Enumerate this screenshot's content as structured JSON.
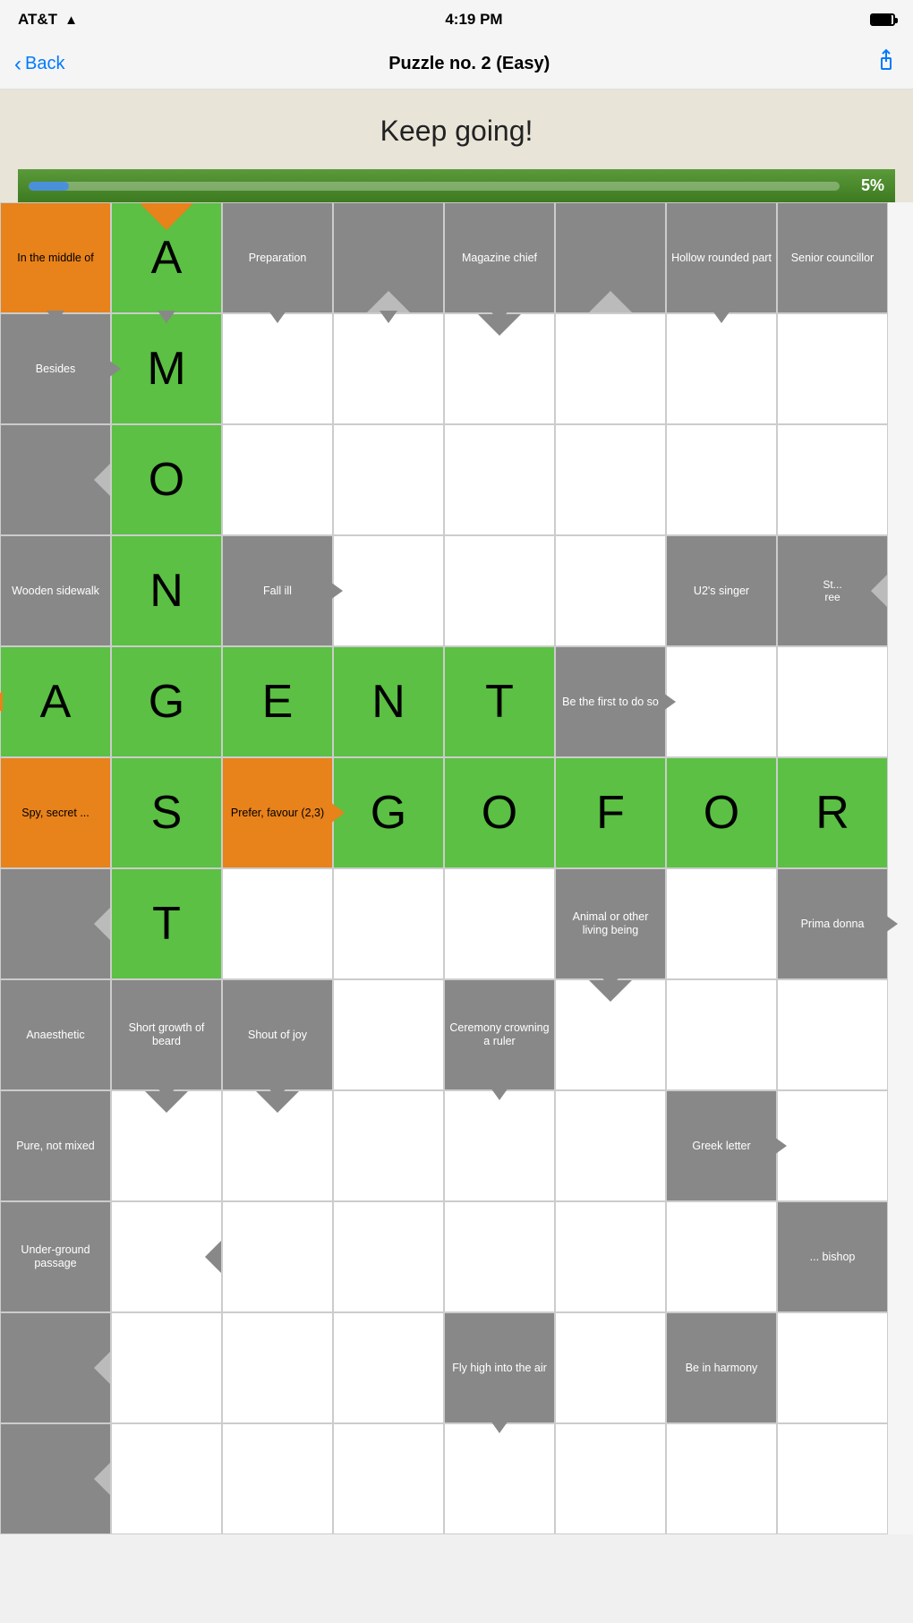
{
  "status": {
    "carrier": "AT&T",
    "time": "4:19 PM"
  },
  "nav": {
    "back_label": "Back",
    "title": "Puzzle no. 2 (Easy)"
  },
  "header": {
    "message": "Keep going!"
  },
  "progress": {
    "percent": "5%",
    "value": 5
  },
  "cells": {
    "r0c0_clue": "In the middle of",
    "r0c1_letter": "A",
    "r0c2_clue": "Preparation",
    "r0c4_clue": "Magazine chief",
    "r0c6_clue": "Hollow rounded part",
    "r0c7_clue": "Senior councillor",
    "r1c0_clue": "Besides",
    "r1c1_letter": "M",
    "r2c1_letter": "O",
    "r3c0_clue": "Wooden sidewalk",
    "r3c1_letter": "N",
    "r3c2_clue": "Fall ill",
    "r3c6_clue": "U2's singer",
    "r4c0_letter": "A",
    "r4c1_letter": "G",
    "r4c2_letter": "E",
    "r4c3_letter": "N",
    "r4c4_letter": "T",
    "r4c5_clue": "Be the first to do so",
    "r5c0_clue": "Spy, secret ...",
    "r5c1_letter": "S",
    "r5c2_clue": "Prefer, favour (2,3)",
    "r5c3_letter": "G",
    "r5c4_letter": "O",
    "r5c5_letter": "F",
    "r5c6_letter": "O",
    "r5c7_letter": "R",
    "r6c1_letter": "T",
    "r6c5_clue": "Animal or other living being",
    "r6c7_clue": "Prima donna",
    "r7c0_clue": "Anaesthetic",
    "r7c1_clue": "Short growth of beard",
    "r7c2_clue": "Shout of joy",
    "r7c4_clue": "Ceremony crowning a ruler",
    "r8c0_clue": "Pure, not mixed",
    "r8c6_clue": "Greek letter",
    "r9c0_clue": "Under-ground passage",
    "r9c7_clue": "... bishop",
    "r10c4_clue": "Fly high into the air",
    "r10c6_clue": "Be in harmony"
  }
}
